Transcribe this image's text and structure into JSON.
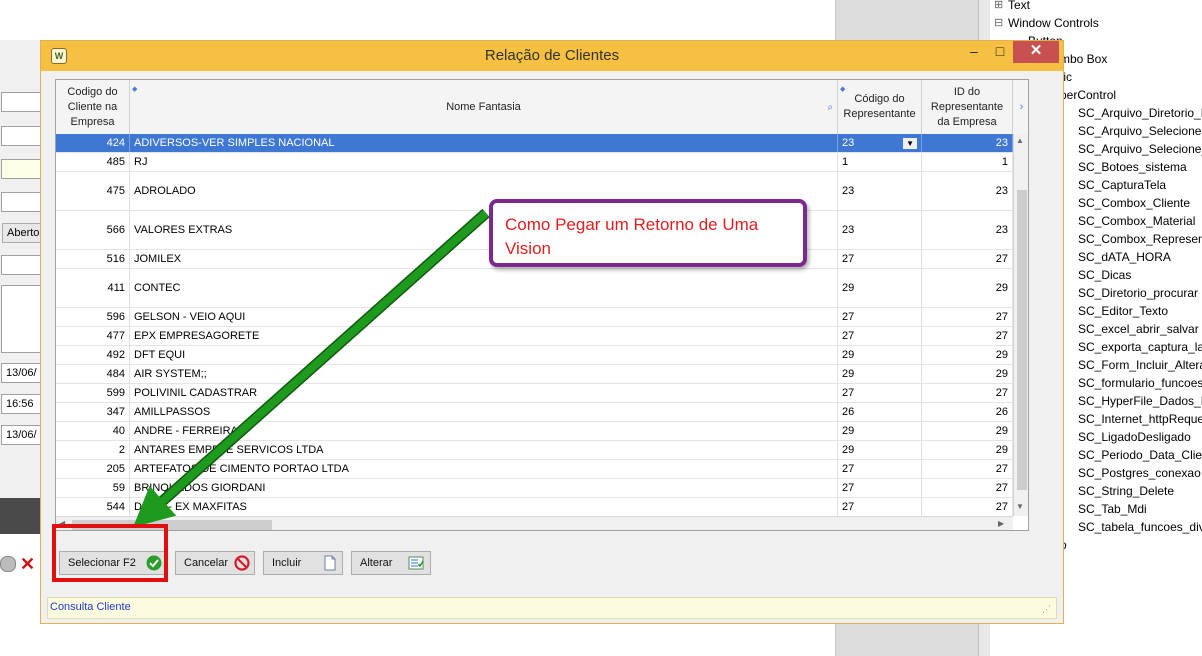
{
  "background_app": {
    "fields": [
      "",
      "",
      "",
      "",
      "",
      "",
      "13/06/",
      "16:56",
      "13/06/"
    ],
    "aberto_button": "Aberto"
  },
  "tree": {
    "items": [
      {
        "indent": 8,
        "prefix": "⊞",
        "label": "Text"
      },
      {
        "indent": 8,
        "prefix": "⊟",
        "label": "Window Controls"
      },
      {
        "indent": 28,
        "prefix": "",
        "label": "Button"
      },
      {
        "indent": 60,
        "prefix": "",
        "label": "mbo Box"
      },
      {
        "indent": 60,
        "prefix": "",
        "label": "tic"
      },
      {
        "indent": 60,
        "prefix": "",
        "label": "perControl"
      },
      {
        "indent": 78,
        "prefix": "",
        "label": "SC_Arquivo_Diretorio_List"
      },
      {
        "indent": 78,
        "prefix": "",
        "label": "SC_Arquivo_Selecione"
      },
      {
        "indent": 78,
        "prefix": "",
        "label": "SC_Arquivo_Selecione_Va"
      },
      {
        "indent": 78,
        "prefix": "",
        "label": "SC_Botoes_sistema"
      },
      {
        "indent": 78,
        "prefix": "",
        "label": "SC_CapturaTela"
      },
      {
        "indent": 78,
        "prefix": "",
        "label": "SC_Combox_Cliente"
      },
      {
        "indent": 78,
        "prefix": "",
        "label": "SC_Combox_Material"
      },
      {
        "indent": 78,
        "prefix": "",
        "label": "SC_Combox_Representan"
      },
      {
        "indent": 78,
        "prefix": "",
        "label": "SC_dATA_HORA"
      },
      {
        "indent": 78,
        "prefix": "",
        "label": "SC_Dicas"
      },
      {
        "indent": 78,
        "prefix": "",
        "label": "SC_Diretorio_procurar"
      },
      {
        "indent": 78,
        "prefix": "",
        "label": "SC_Editor_Texto"
      },
      {
        "indent": 78,
        "prefix": "",
        "label": "SC_excel_abrir_salvar"
      },
      {
        "indent": 78,
        "prefix": "",
        "label": "SC_exporta_captura_lado"
      },
      {
        "indent": 78,
        "prefix": "",
        "label": "SC_Form_Incluir_Alterar_E"
      },
      {
        "indent": 78,
        "prefix": "",
        "label": "SC_formulario_funcoes_d"
      },
      {
        "indent": 78,
        "prefix": "",
        "label": "SC_HyperFile_Dados_BAn"
      },
      {
        "indent": 78,
        "prefix": "",
        "label": "SC_Internet_httpRequest"
      },
      {
        "indent": 78,
        "prefix": "",
        "label": "SC_LigadoDesligado"
      },
      {
        "indent": 78,
        "prefix": "",
        "label": "SC_Periodo_Data_Cliente"
      },
      {
        "indent": 78,
        "prefix": "",
        "label": "SC_Postgres_conexao"
      },
      {
        "indent": 78,
        "prefix": "",
        "label": "SC_String_Delete"
      },
      {
        "indent": 78,
        "prefix": "",
        "label": "SC_Tab_Mdi"
      },
      {
        "indent": 78,
        "prefix": "",
        "label": "SC_tabela_funcoes_divers"
      },
      {
        "indent": 60,
        "prefix": "",
        "label": "o"
      }
    ]
  },
  "dialog": {
    "title": "Relação de Clientes",
    "columns": {
      "code": "Codigo do Cliente na Empresa",
      "name": "Nome Fantasia",
      "rep": "Código do Representante",
      "id": "ID do Representante da Empresa"
    },
    "rows": [
      {
        "code": "424",
        "name": "ADIVERSOS-VER SIMPLES NACIONAL",
        "rep": "23",
        "id": "23",
        "selected": true,
        "tall": false
      },
      {
        "code": "485",
        "name": "RJ",
        "rep": "1",
        "id": "1",
        "selected": false,
        "tall": false
      },
      {
        "code": "475",
        "name": "ADROLADO",
        "rep": "23",
        "id": "23",
        "selected": false,
        "tall": true
      },
      {
        "code": "566",
        "name": "VALORES EXTRAS",
        "rep": "23",
        "id": "23",
        "selected": false,
        "tall": true
      },
      {
        "code": "516",
        "name": "JOMILEX",
        "rep": "27",
        "id": "27",
        "selected": false,
        "tall": false
      },
      {
        "code": "411",
        "name": "CONTEC",
        "rep": "29",
        "id": "29",
        "selected": false,
        "tall": true
      },
      {
        "code": "596",
        "name": "GELSON - VEIO AQUI",
        "rep": "27",
        "id": "27",
        "selected": false,
        "tall": false
      },
      {
        "code": "477",
        "name": "EPX EMPRESAGORETE",
        "rep": "27",
        "id": "27",
        "selected": false,
        "tall": false
      },
      {
        "code": "492",
        "name": "DFT EQUI",
        "rep": "29",
        "id": "29",
        "selected": false,
        "tall": false
      },
      {
        "code": "484",
        "name": "AIR SYSTEM;;",
        "rep": "29",
        "id": "29",
        "selected": false,
        "tall": false
      },
      {
        "code": "599",
        "name": "POLIVINIL CADASTRAR",
        "rep": "27",
        "id": "27",
        "selected": false,
        "tall": false
      },
      {
        "code": "347",
        "name": "AMILLPASSOS",
        "rep": "26",
        "id": "26",
        "selected": false,
        "tall": false
      },
      {
        "code": "40",
        "name": "ANDRE - FERREIRA",
        "rep": "29",
        "id": "29",
        "selected": false,
        "tall": false
      },
      {
        "code": "2",
        "name": "ANTARES EMPR. E SERVICOS LTDA",
        "rep": "29",
        "id": "29",
        "selected": false,
        "tall": false
      },
      {
        "code": "205",
        "name": "ARTEFATOS DE CIMENTO PORTAO LTDA",
        "rep": "27",
        "id": "27",
        "selected": false,
        "tall": false
      },
      {
        "code": "59",
        "name": "BRINQUEDOS GIORDANI",
        "rep": "27",
        "id": "27",
        "selected": false,
        "tall": false
      },
      {
        "code": "544",
        "name": "DEMA - EX MAXFITAS",
        "rep": "27",
        "id": "27",
        "selected": false,
        "tall": false
      }
    ],
    "buttons": {
      "select": "Selecionar F2",
      "cancel": "Cancelar",
      "include": "Incluir",
      "alter": "Alterar"
    },
    "status": "Consulta Cliente"
  },
  "callout": {
    "text": "Como Pegar um Retorno de Uma Vision"
  },
  "colors": {
    "titlebar": "#f6c142",
    "selection": "#3e78d2",
    "arrow": "#1e9a1e",
    "callout_border": "#7a2a8f",
    "callout_text": "#e02020",
    "highlight_box": "#e01010"
  }
}
